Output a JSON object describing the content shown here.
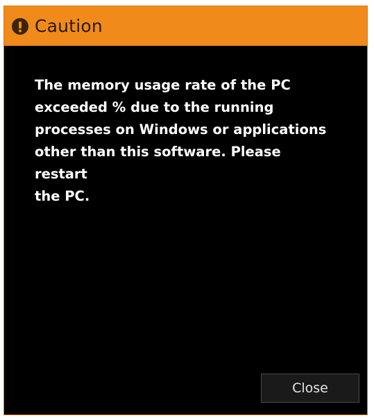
{
  "dialog": {
    "title": "Caution",
    "message": "The memory usage rate of the PC\nexceeded  % due to the running\nprocesses on Windows or applications\nother than this software. Please restart\nthe PC.",
    "close_label": "Close",
    "icons": {
      "title": "exclamation-icon"
    },
    "colors": {
      "titlebar": "#f08a1a",
      "background": "#000000",
      "text": "#ffffff"
    }
  }
}
